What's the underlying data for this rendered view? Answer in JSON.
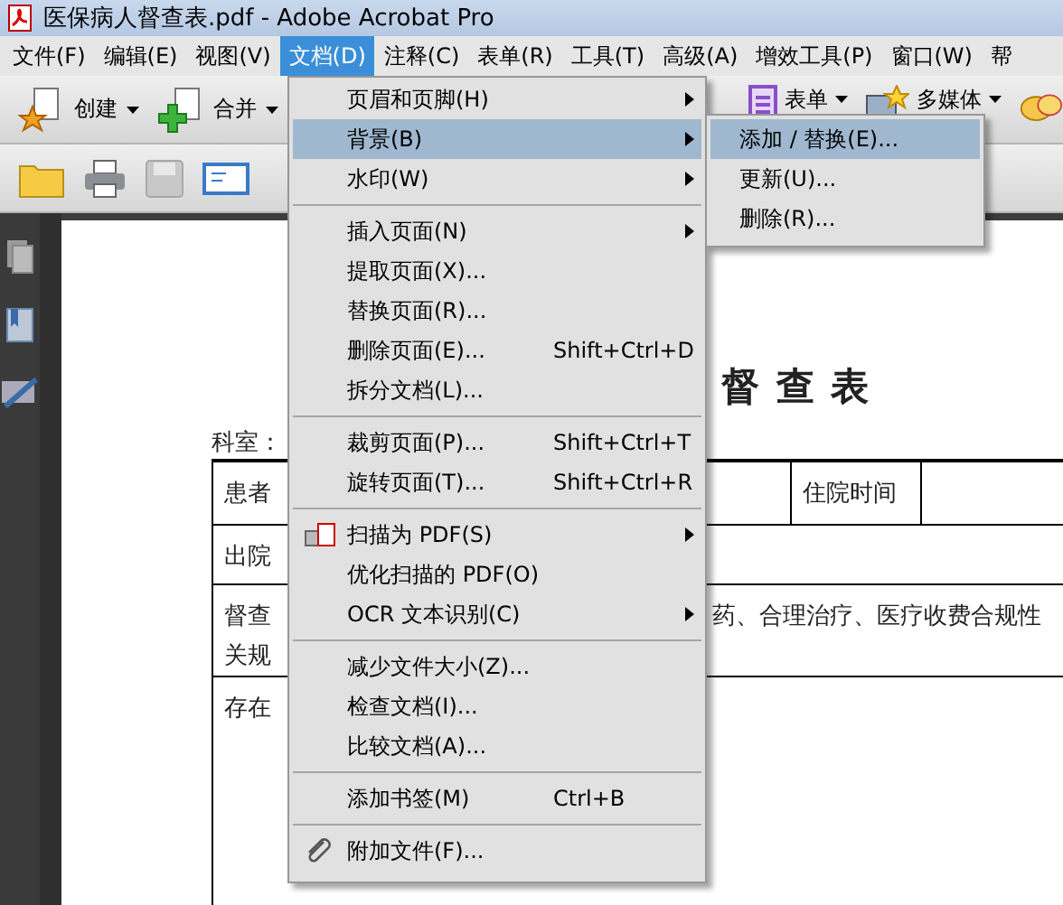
{
  "window": {
    "title": "医保病人督查表.pdf - Adobe Acrobat Pro"
  },
  "menubar": [
    {
      "label": "文件(F)",
      "selected": false
    },
    {
      "label": "编辑(E)",
      "selected": false
    },
    {
      "label": "视图(V)",
      "selected": false
    },
    {
      "label": "文档(D)",
      "selected": true
    },
    {
      "label": "注释(C)",
      "selected": false
    },
    {
      "label": "表单(R)",
      "selected": false
    },
    {
      "label": "工具(T)",
      "selected": false
    },
    {
      "label": "高级(A)",
      "selected": false
    },
    {
      "label": "增效工具(P)",
      "selected": false
    },
    {
      "label": "窗口(W)",
      "selected": false
    },
    {
      "label": "帮",
      "selected": false
    }
  ],
  "toolbar": {
    "left": [
      {
        "label": "创建",
        "kind": "create"
      },
      {
        "label": "合并",
        "kind": "combine"
      }
    ],
    "right": [
      {
        "label": "表单",
        "kind": "form"
      },
      {
        "label": "多媒体",
        "kind": "media"
      }
    ]
  },
  "menu": {
    "items": [
      {
        "kind": "item",
        "label": "页眉和页脚(H)",
        "submenu": true,
        "selected": false
      },
      {
        "kind": "item",
        "label": "背景(B)",
        "submenu": true,
        "selected": true
      },
      {
        "kind": "item",
        "label": "水印(W)",
        "submenu": true,
        "selected": false
      },
      {
        "kind": "separator"
      },
      {
        "kind": "item",
        "label": "插入页面(N)",
        "submenu": true,
        "selected": false
      },
      {
        "kind": "item",
        "label": "提取页面(X)...",
        "selected": false
      },
      {
        "kind": "item",
        "label": "替换页面(R)...",
        "selected": false
      },
      {
        "kind": "item",
        "label": "删除页面(E)...",
        "shortcut": "Shift+Ctrl+D",
        "selected": false
      },
      {
        "kind": "item",
        "label": "拆分文档(L)...",
        "selected": false
      },
      {
        "kind": "separator"
      },
      {
        "kind": "item",
        "label": "裁剪页面(P)...",
        "shortcut": "Shift+Ctrl+T",
        "selected": false
      },
      {
        "kind": "item",
        "label": "旋转页面(T)...",
        "shortcut": "Shift+Ctrl+R",
        "selected": false
      },
      {
        "kind": "separator"
      },
      {
        "kind": "scan",
        "label": "扫描为 PDF(S)",
        "submenu": true,
        "selected": false
      },
      {
        "kind": "item",
        "label": "优化扫描的 PDF(O)",
        "selected": false
      },
      {
        "kind": "item",
        "label": "OCR 文本识别(C)",
        "submenu": true,
        "selected": false
      },
      {
        "kind": "separator"
      },
      {
        "kind": "item",
        "label": "减少文件大小(Z)...",
        "selected": false
      },
      {
        "kind": "item",
        "label": "检查文档(I)...",
        "selected": false
      },
      {
        "kind": "item",
        "label": "比较文档(A)...",
        "selected": false
      },
      {
        "kind": "separator"
      },
      {
        "kind": "item",
        "label": "添加书签(M)",
        "shortcut": "Ctrl+B",
        "selected": false
      },
      {
        "kind": "separator"
      },
      {
        "kind": "attach",
        "label": "附加文件(F)...",
        "selected": false
      }
    ],
    "submenu": [
      {
        "label": "添加 / 替换(E)...",
        "selected": true
      },
      {
        "label": "更新(U)...",
        "selected": false
      },
      {
        "label": "删除(R)...",
        "selected": false
      }
    ]
  },
  "document": {
    "department": "科室：",
    "title": "督 查 表",
    "rows": [
      {
        "left": "患者",
        "middle": "住院时间"
      },
      {
        "left": "出院"
      },
      {
        "left": "督查",
        "right": "药、合理治疗、医疗收费合规性",
        "left2": "关规"
      },
      {
        "left": "存在"
      }
    ]
  }
}
